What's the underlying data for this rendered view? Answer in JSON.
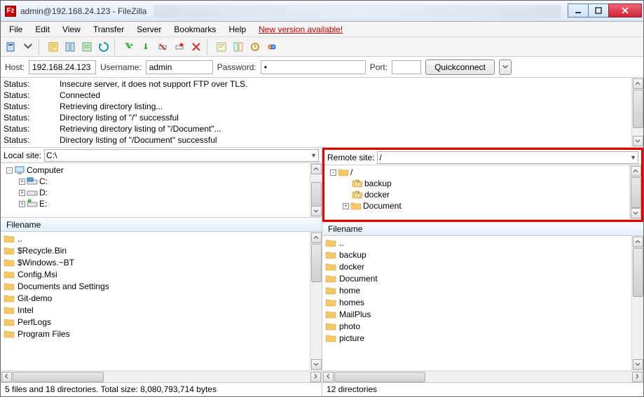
{
  "window": {
    "title": "admin@192.168.24.123 - FileZilla",
    "app_icon_text": "Fz"
  },
  "menu": [
    "File",
    "Edit",
    "View",
    "Transfer",
    "Server",
    "Bookmarks",
    "Help"
  ],
  "new_version_label": "New version available!",
  "quickconnect": {
    "host_label": "Host:",
    "host": "192.168.24.123",
    "user_label": "Username:",
    "user": "admin",
    "pass_label": "Password:",
    "pass": "•",
    "port_label": "Port:",
    "port": "",
    "button": "Quickconnect"
  },
  "log": [
    {
      "k": "Status:",
      "v": "Insecure server, it does not support FTP over TLS."
    },
    {
      "k": "Status:",
      "v": "Connected"
    },
    {
      "k": "Status:",
      "v": "Retrieving directory listing..."
    },
    {
      "k": "Status:",
      "v": "Directory listing of \"/\" successful"
    },
    {
      "k": "Status:",
      "v": "Retrieving directory listing of \"/Document\"..."
    },
    {
      "k": "Status:",
      "v": "Directory listing of \"/Document\" successful"
    }
  ],
  "local": {
    "site_label": "Local site:",
    "site_value": "C:\\",
    "tree": [
      {
        "indent": 0,
        "exp": "-",
        "icon": "computer",
        "label": "Computer"
      },
      {
        "indent": 1,
        "exp": "+",
        "icon": "drive-c",
        "label": "C:"
      },
      {
        "indent": 1,
        "exp": "+",
        "icon": "drive",
        "label": "D:"
      },
      {
        "indent": 1,
        "exp": "+",
        "icon": "drive-net",
        "label": "E:"
      }
    ],
    "list_header": "Filename",
    "files": [
      "..",
      "$Recycle.Bin",
      "$Windows.~BT",
      "Config.Msi",
      "Documents and Settings",
      "Git-demo",
      "Intel",
      "PerfLogs",
      "Program Files"
    ],
    "status": "5 files and 18 directories. Total size: 8,080,793,714 bytes"
  },
  "remote": {
    "site_label": "Remote site:",
    "site_value": "/",
    "tree": [
      {
        "indent": 0,
        "exp": "-",
        "icon": "folder",
        "label": "/"
      },
      {
        "indent": 1,
        "exp": "",
        "icon": "folder-q",
        "label": "backup"
      },
      {
        "indent": 1,
        "exp": "",
        "icon": "folder-q",
        "label": "docker"
      },
      {
        "indent": 1,
        "exp": "+",
        "icon": "folder",
        "label": "Document"
      }
    ],
    "list_header": "Filename",
    "files": [
      "..",
      "backup",
      "docker",
      "Document",
      "home",
      "homes",
      "MailPlus",
      "photo",
      "picture"
    ],
    "status": "12 directories"
  }
}
